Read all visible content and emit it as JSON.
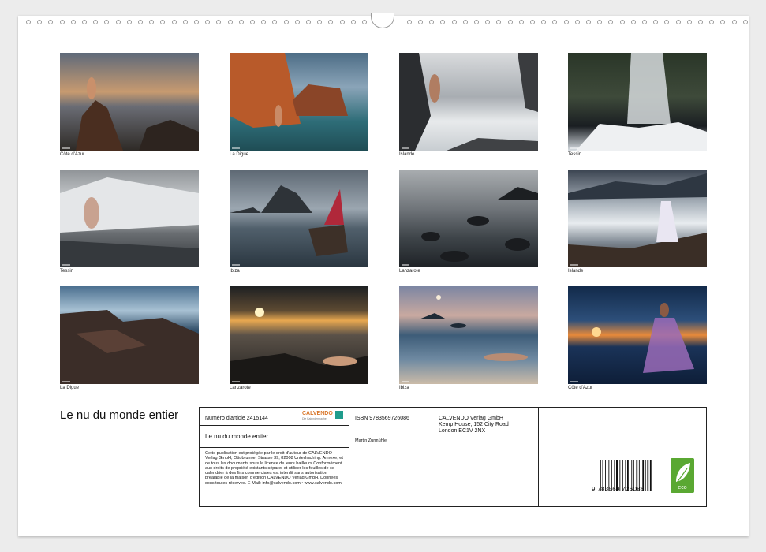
{
  "gallery": [
    {
      "caption": "Côte d'Azur"
    },
    {
      "caption": "La Digue"
    },
    {
      "caption": "Islande"
    },
    {
      "caption": "Tessin"
    },
    {
      "caption": "Tessin"
    },
    {
      "caption": "Ibiza"
    },
    {
      "caption": "Lanzarote"
    },
    {
      "caption": "Islande"
    },
    {
      "caption": "La Digue"
    },
    {
      "caption": "Lanzarote"
    },
    {
      "caption": "Ibiza"
    },
    {
      "caption": "Côte d'Azur"
    }
  ],
  "title": "Le nu du monde entier",
  "info": {
    "article": "Numéro d'article 2415144",
    "brand": "CALVENDO",
    "brand_tagline": "Die Kalendermacher",
    "name": "Le nu du monde entier",
    "copyright": "Cette publication est protégée par le droit d'auteur de CALVENDO Verlag GmbH, Ottobrunner Strasse 39, 82008 Unterhaching. Annexe, et de tous les documents sous la licence de leurs bailleurs.Conformément aux droits de propriété existants séparer et utiliser les feuilles de ce calendrier à des fins commerciales est interdit sans autorisation préalable de la maison d'édition  CALVENDO Verlag GmbH. Données sous toutes réserves. E-Mail: info@calvendo.com • www.calvendo.com",
    "isbn": "ISBN 9783569726086",
    "publisher1": "CALVENDO Verlag GmbH",
    "publisher2": "Kemp House, 152 City Road",
    "publisher3": "London EC1V 2NX",
    "author": "Martin Zurmühle",
    "barcode_digits": "9 783569 726086",
    "eco_label": "eco"
  }
}
